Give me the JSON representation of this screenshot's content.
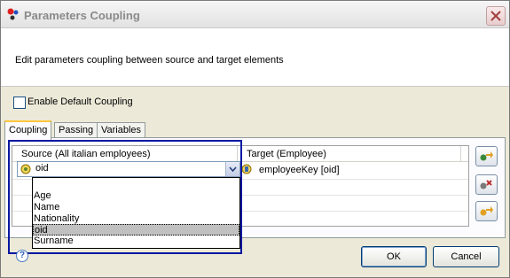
{
  "window": {
    "title": "Parameters Coupling"
  },
  "header": {
    "description": "Edit parameters coupling between source and target elements"
  },
  "options": {
    "enable_default_coupling": "Enable Default Coupling",
    "enable_default_coupling_checked": false
  },
  "tabs": [
    {
      "label": "Coupling",
      "active": true
    },
    {
      "label": "Passing",
      "active": false
    },
    {
      "label": "Variables",
      "active": false
    }
  ],
  "table": {
    "columns": {
      "source": "Source (All italian employees)",
      "target": "Target (Employee)"
    },
    "rows": [
      {
        "source": "oid",
        "target": "employeeKey [oid]"
      }
    ]
  },
  "dropdown": {
    "selected": "oid",
    "options": [
      "",
      "Age",
      "Name",
      "Nationality",
      "oid",
      "Surname"
    ]
  },
  "buttons": {
    "ok": "OK",
    "cancel": "Cancel",
    "help": "?"
  },
  "colors": {
    "highlight_border": "#0018a0",
    "tab_active_accent": "#ffc83c",
    "selected_item": "#c0c0c0"
  },
  "icons": [
    "app-logo-icon",
    "close-icon",
    "oid-parameter-icon",
    "target-parameter-icon",
    "add-coupling-icon",
    "remove-coupling-icon",
    "auto-coupling-icon",
    "help-icon"
  ]
}
